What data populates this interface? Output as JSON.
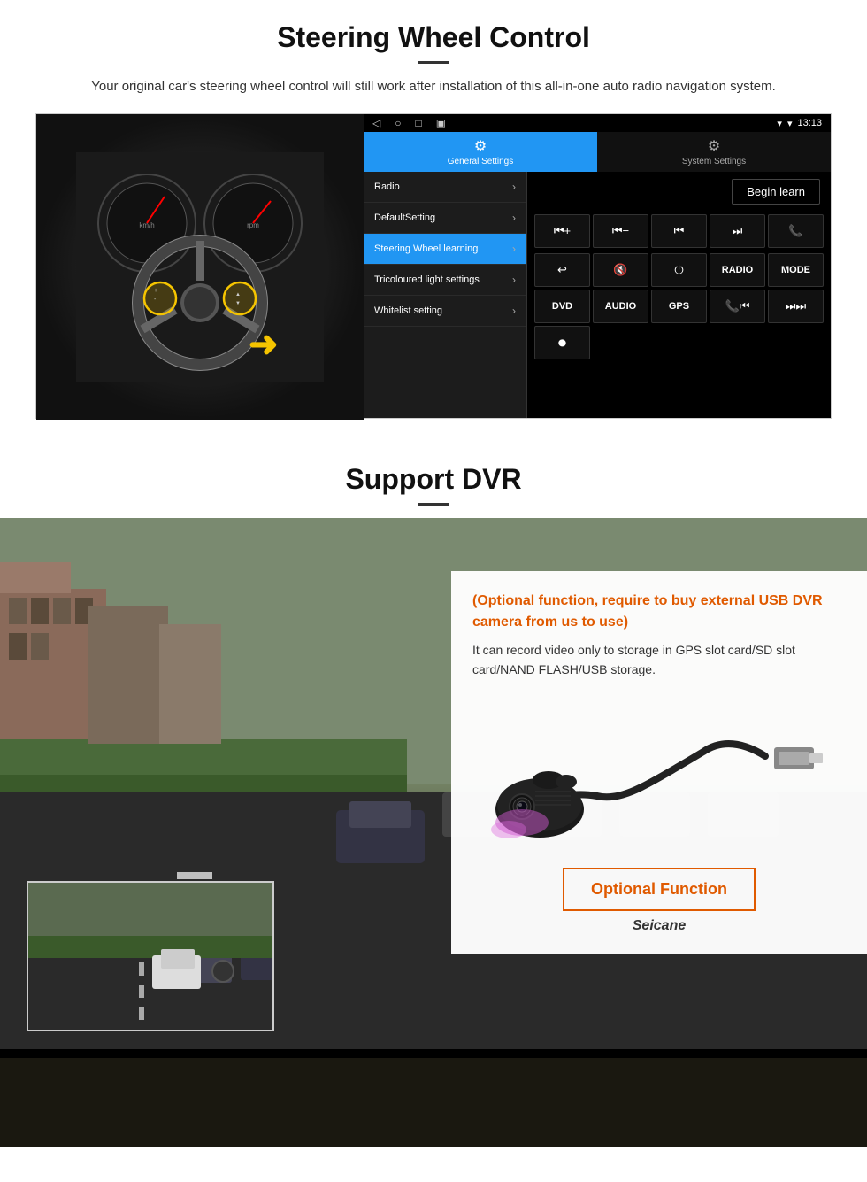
{
  "page": {
    "steering_section": {
      "title": "Steering Wheel Control",
      "description": "Your original car's steering wheel control will still work after installation of this all-in-one auto radio navigation system.",
      "statusbar": {
        "time": "13:13",
        "signal_icon": "📶",
        "wifi_icon": "▾"
      },
      "tabs": [
        {
          "id": "general",
          "icon": "⚙",
          "label": "General Settings",
          "active": true
        },
        {
          "id": "system",
          "icon": "⚙",
          "label": "System Settings",
          "active": false
        }
      ],
      "menu_items": [
        {
          "id": "radio",
          "label": "Radio",
          "active": false
        },
        {
          "id": "default",
          "label": "DefaultSetting",
          "active": false
        },
        {
          "id": "steering",
          "label": "Steering Wheel learning",
          "active": true
        },
        {
          "id": "tricoloured",
          "label": "Tricoloured light settings",
          "active": false
        },
        {
          "id": "whitelist",
          "label": "Whitelist setting",
          "active": false
        }
      ],
      "begin_learn_label": "Begin learn",
      "control_buttons_row1": [
        "⏮+",
        "⏮-",
        "⏮",
        "⏭",
        "📞"
      ],
      "control_buttons_row2": [
        "↩",
        "🔇",
        "⏻",
        "RADIO",
        "MODE"
      ],
      "control_buttons_row3": [
        "DVD",
        "AUDIO",
        "GPS",
        "📞⏮",
        "⏭⏭"
      ],
      "control_buttons_row4": [
        "⏺"
      ]
    },
    "dvr_section": {
      "title": "Support DVR",
      "optional_text": "(Optional function, require to buy external USB DVR camera from us to use)",
      "description": "It can record video only to storage in GPS slot card/SD slot card/NAND FLASH/USB storage.",
      "optional_function_label": "Optional Function",
      "brand_label": "Seicane"
    }
  }
}
